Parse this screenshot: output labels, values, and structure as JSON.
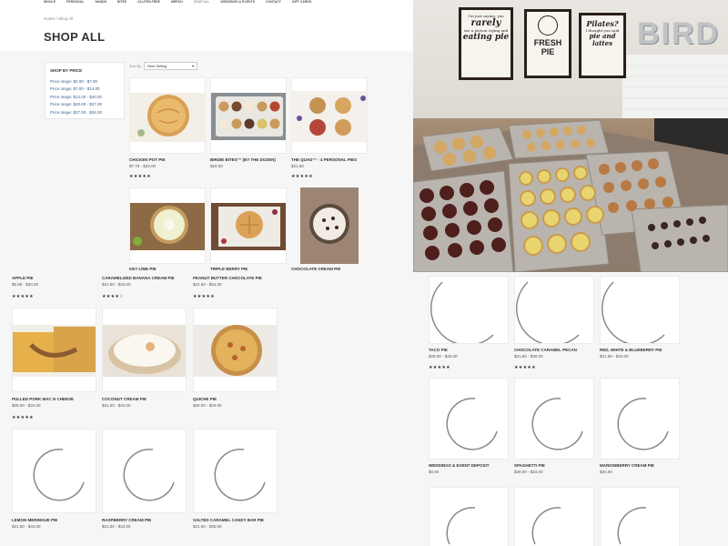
{
  "nav": {
    "items": [
      "WHOLE",
      "PERSONAL",
      "HANDS",
      "BITES",
      "GLUTEN FREE",
      "MERCH",
      "SHOP ALL",
      "WEDDINGS & EVENTS",
      "CONTACT",
      "GIFT CARDS"
    ]
  },
  "breadcrumb": {
    "home": "Home",
    "separator": "/",
    "current": "Shop All"
  },
  "page_title": "SHOP ALL",
  "filter": {
    "title": "SHOP BY PRICE",
    "ranges": [
      "Price range: $0.00 - $7.00",
      "Price range: $7.00 - $14.00",
      "Price range: $14.00 - $20.00",
      "Price range: $20.00 - $27.00",
      "Price range: $27.00 - $34.00"
    ]
  },
  "sort": {
    "label": "Sort By",
    "value": "Best Selling"
  },
  "products_top": [
    {
      "name": "CHICKEN POT PIE",
      "price": "$7.79 - $34.00",
      "stars": "★★★★★"
    },
    {
      "name": "BIRDIE BITES™ (BY THE DOZEN)",
      "price": "$18.00",
      "stars": ""
    },
    {
      "name": "THE QUAD™ - 4 PERSONAL PIES",
      "price": "$21.50",
      "stars": "★★★★★"
    },
    {
      "name": "KEY LIME PIE",
      "price": "",
      "stars": ""
    },
    {
      "name": "TRIPLE BERRY PIE",
      "price": "",
      "stars": ""
    },
    {
      "name": "CHOCOLATE CREAM PIE",
      "price": "",
      "stars": ""
    }
  ],
  "photo": {
    "signs": [
      {
        "line1": "I'm just saying, you",
        "big": "rarely",
        "line2": "see a person crying and",
        "big2": "eating pie"
      },
      {
        "line1": "",
        "big": "FRESH",
        "line2": "",
        "big2": "PIE"
      },
      {
        "line1": "",
        "big": "Pilates?",
        "line2": "I thought you said",
        "big2": "pie and lattes"
      }
    ],
    "wall_letters": "BIRD"
  },
  "products_left": [
    {
      "name": "APPLE PIE",
      "price": "$5.95 - $30.00",
      "stars": "★★★★★"
    },
    {
      "name": "CARAMELIZED BANANA CREAM PIE",
      "price": "$21.50 - $34.00",
      "stars": "★★★★☆"
    },
    {
      "name": "PEANUT BUTTER CHOCOLATE PIE",
      "price": "$21.50 - $34.00",
      "stars": "★★★★★"
    },
    {
      "name": "PULLED PORK MAC N CHEESE",
      "price": "$28.00 - $34.00",
      "stars": "★★★★★"
    },
    {
      "name": "COCONUT CREAM PIE",
      "price": "$21.50 - $34.00",
      "stars": ""
    },
    {
      "name": "QUICHE PIE",
      "price": "$28.00 - $34.00",
      "stars": ""
    },
    {
      "name": "LEMON MERINGUE PIE",
      "price": "$21.50 - $34.00",
      "stars": ""
    },
    {
      "name": "RASPBERRY CREAM PIE",
      "price": "$21.50 - $34.00",
      "stars": ""
    },
    {
      "name": "SALTED CARAMEL CANDY BAR PIE",
      "price": "$21.50 - $30.00",
      "stars": ""
    }
  ],
  "products_right": [
    {
      "name": "TACO PIE",
      "price": "$28.00 - $34.00",
      "stars": "★★★★★"
    },
    {
      "name": "CHOCOLATE CARAMEL PECAN",
      "price": "$21.50 - $30.00",
      "stars": "★★★★★"
    },
    {
      "name": "RED, WHITE & BLUEBERRY PIE",
      "price": "$21.50 - $34.00",
      "stars": ""
    },
    {
      "name": "WEDDINGS & EVENT DEPOSIT",
      "price": "$0.00",
      "stars": ""
    },
    {
      "name": "SPAGHETTI PIE",
      "price": "$28.00 - $34.00",
      "stars": ""
    },
    {
      "name": "MARIONBERRY CREAM PIE",
      "price": "$30.00",
      "stars": ""
    }
  ],
  "colors": {
    "accent_link": "#3a5e8c",
    "page_bg": "#f6f6f6",
    "loader": "#888888"
  },
  "icons": {
    "loader": "loading-spinner-icon",
    "dropdown": "chevron-down-icon"
  }
}
